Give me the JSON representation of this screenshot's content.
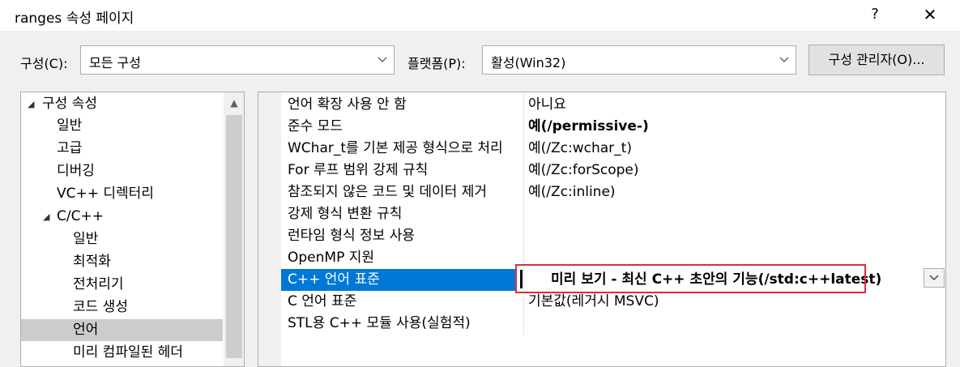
{
  "window": {
    "title": "ranges 속성 페이지",
    "help": "?",
    "close": "✕"
  },
  "toolbar": {
    "config_label": "구성(C):",
    "config_value": "모든 구성",
    "platform_label": "플랫폼(P):",
    "platform_value": "활성(Win32)",
    "config_manager": "구성 관리자(O)..."
  },
  "tree": {
    "items": [
      {
        "label": "구성 속성",
        "expander": "◢"
      },
      {
        "label": "일반"
      },
      {
        "label": "고급"
      },
      {
        "label": "디버깅"
      },
      {
        "label": "VC++ 디렉터리"
      },
      {
        "label": "C/C++",
        "expander": "◢"
      },
      {
        "label": "일반"
      },
      {
        "label": "최적화"
      },
      {
        "label": "전처리기"
      },
      {
        "label": "코드 생성"
      },
      {
        "label": "언어",
        "selected": true
      },
      {
        "label": "미리 컴파일된 헤더"
      }
    ]
  },
  "properties": {
    "rows": [
      {
        "name": "언어 확장 사용 안 함",
        "value": "아니요"
      },
      {
        "name": "준수 모드",
        "value": "예(/permissive-)"
      },
      {
        "name": "WChar_t를 기본 제공 형식으로 처리",
        "value": "예(/Zc:wchar_t)"
      },
      {
        "name": "For 루프 범위 강제 규칙",
        "value": "예(/Zc:forScope)"
      },
      {
        "name": "참조되지 않은 코드 및 데이터 제거",
        "value": "예(/Zc:inline)"
      },
      {
        "name": "강제 형식 변환 규칙",
        "value": ""
      },
      {
        "name": "런타임 형식 정보 사용",
        "value": ""
      },
      {
        "name": "OpenMP 지원",
        "value": ""
      },
      {
        "name": "C++ 언어 표준",
        "value": "미리 보기 - 최신 C++ 초안의 기능(/std:c++latest)"
      },
      {
        "name": "C 언어 표준",
        "value": "기본값(레거시 MSVC)"
      },
      {
        "name": "STL용 C++ 모듈 사용(실험적)",
        "value": ""
      }
    ]
  },
  "colors": {
    "selection": "#0078d7",
    "highlight_border": "#d9303a"
  }
}
